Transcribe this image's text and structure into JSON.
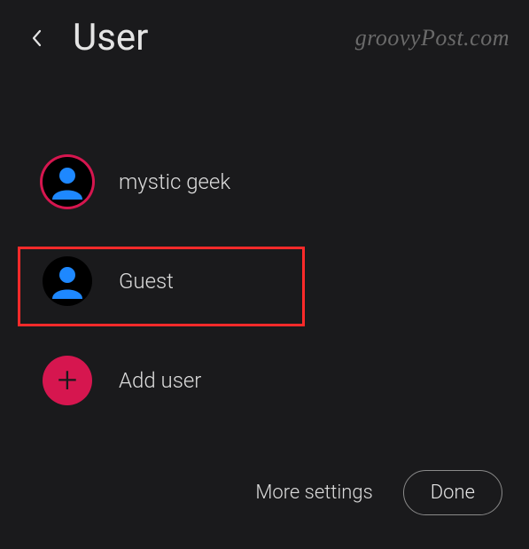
{
  "header": {
    "title": "User"
  },
  "watermark": "groovyPost.com",
  "users": [
    {
      "label": "mystic geek"
    },
    {
      "label": "Guest"
    },
    {
      "label": "Add user"
    }
  ],
  "footer": {
    "more": "More settings",
    "done": "Done"
  }
}
